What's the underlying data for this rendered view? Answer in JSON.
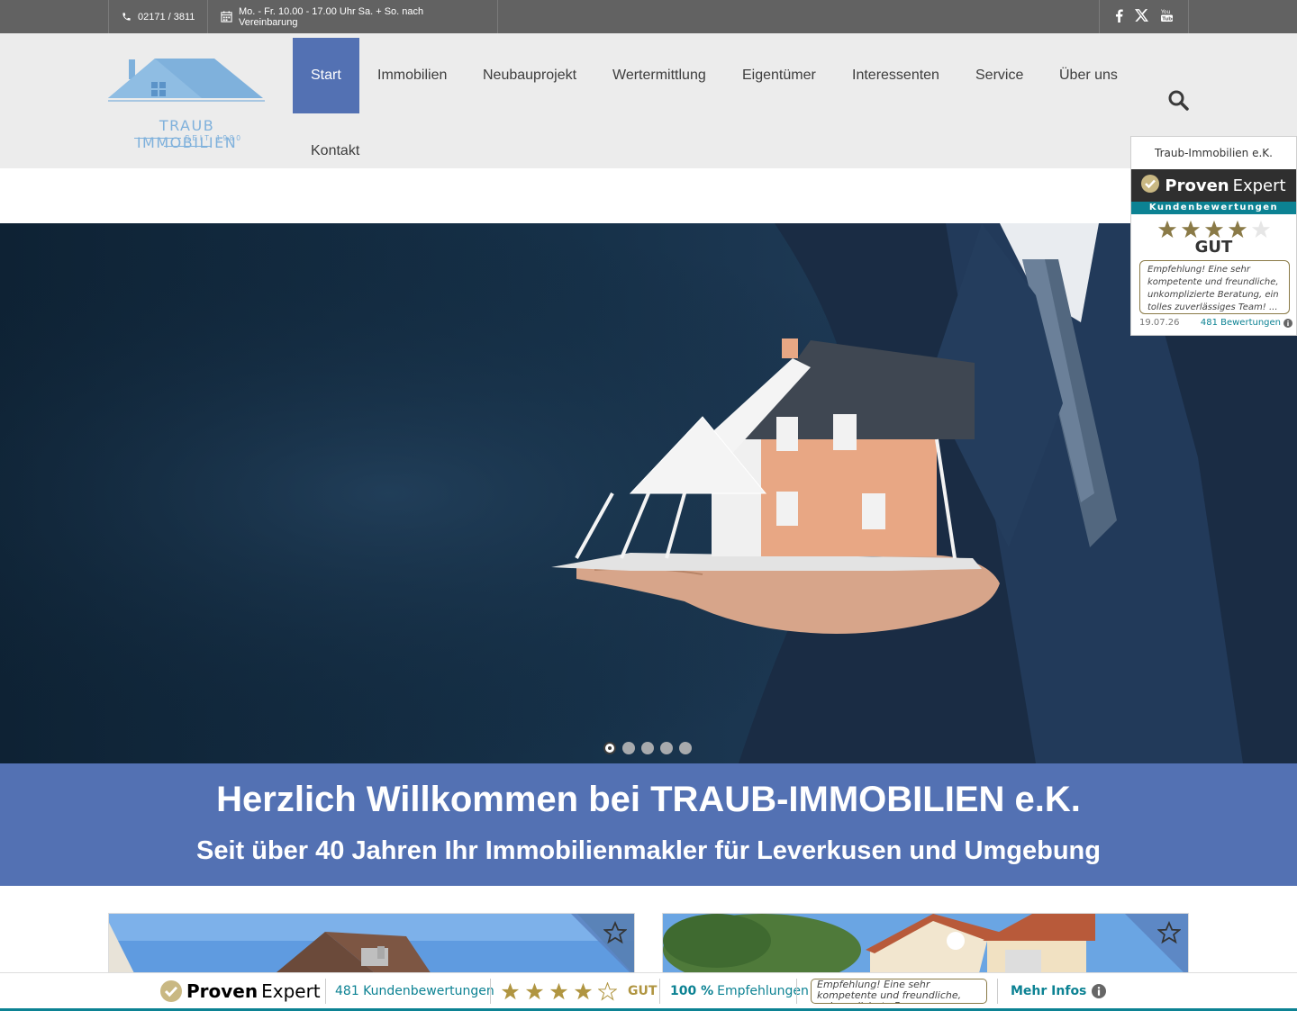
{
  "topbar": {
    "phone": "02171 / 3811",
    "hours": "Mo. - Fr. 10.00 - 17.00 Uhr Sa. + So. nach Vereinbarung",
    "social": [
      "facebook-icon",
      "x-icon",
      "youtube-icon"
    ]
  },
  "logo": {
    "name": "TRAUB IMMOBILIEN",
    "sub": "SEIT 1980",
    "color": "#7fb1dc"
  },
  "nav": {
    "items": [
      "Start",
      "Immobilien",
      "Neubauprojekt",
      "Wertermittlung",
      "Eigentümer",
      "Interessenten",
      "Service",
      "Über uns",
      "Kontakt"
    ],
    "active": "Start",
    "accent": "#5371b3"
  },
  "proven_widget": {
    "company": "Traub-Immobilien e.K.",
    "brand_bold": "Proven",
    "brand_light": "Expert",
    "subtitle": "Kundenbewertungen",
    "stars": 4,
    "grade": "GUT",
    "quote": "Empfehlung! Eine sehr kompetente und freundliche, unkomplizierte Beratung, ein tolles zuverlässiges Team! ...",
    "date": "19.07.26",
    "count": "481 Bewertungen"
  },
  "hero": {
    "slides": 5,
    "active_slide": 1
  },
  "banner": {
    "title": "Herzlich Willkommen bei TRAUB-IMMOBILIEN e.K.",
    "subtitle": "Seit über 40 Jahren Ihr Immobilienmakler für Leverkusen und Umgebung"
  },
  "proven_bar": {
    "brand_bold": "Proven",
    "brand_light": "Expert",
    "reviews": "481 Kundenbewertungen",
    "stars": 4,
    "grade": "GUT",
    "recommend_pct": "100 %",
    "recommend_label": "Empfehlungen",
    "quote": "Empfehlung! Eine sehr kompetente und freundliche, unkomplizierte Be...",
    "more": "Mehr Infos",
    "teal": "#0c8293",
    "gold": "#b09541"
  }
}
